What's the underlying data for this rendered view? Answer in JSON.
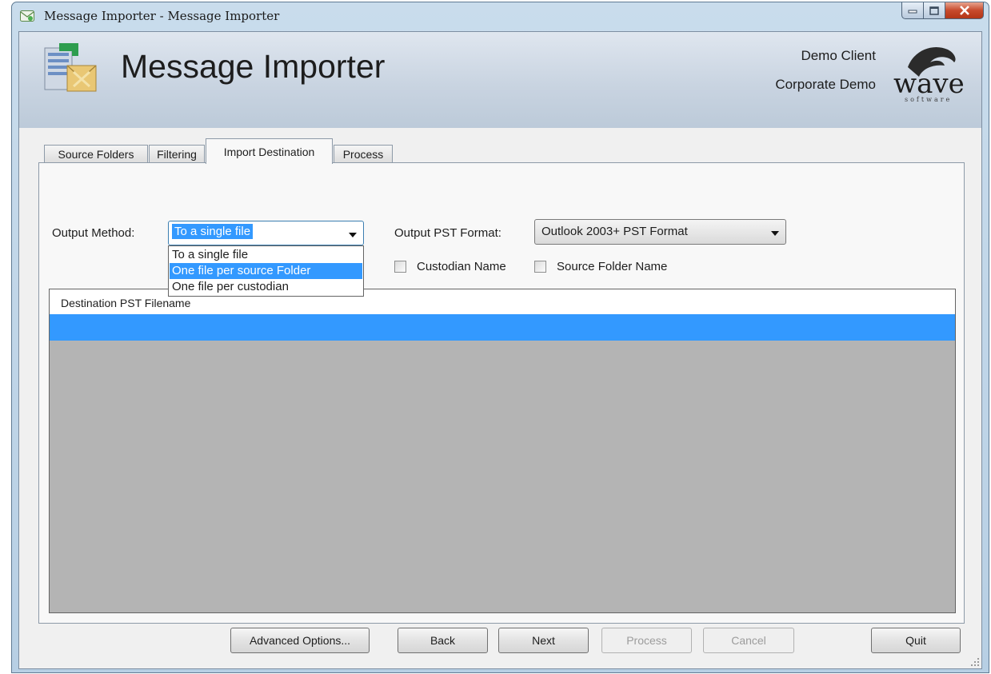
{
  "window": {
    "title": "Message Importer - Message Importer"
  },
  "header": {
    "app_title": "Message Importer",
    "client": "Demo Client",
    "corporate": "Corporate Demo",
    "logo_text": "wave",
    "logo_subtext": "software"
  },
  "tabs": [
    {
      "label": "Source Folders",
      "active": false
    },
    {
      "label": "Filtering",
      "active": false
    },
    {
      "label": "Import Destination",
      "active": true
    },
    {
      "label": "Process",
      "active": false
    }
  ],
  "output_method": {
    "label": "Output Method:",
    "value": "To a single file",
    "options": [
      "To a single file",
      "One file per source Folder",
      "One file per custodian"
    ],
    "highlighted_option": "One file per source Folder"
  },
  "output_pst_format": {
    "label": "Output PST Format:",
    "value": "Outlook 2003+ PST Format"
  },
  "checkboxes": [
    {
      "label": "Custodian Name",
      "checked": false
    },
    {
      "label": "Source Folder Name",
      "checked": false
    }
  ],
  "grid": {
    "column_header": "Destination PST Filename",
    "rows": [
      ""
    ]
  },
  "buttons": {
    "advanced": "Advanced Options...",
    "back": "Back",
    "next": "Next",
    "process": "Process",
    "cancel": "Cancel",
    "quit": "Quit"
  },
  "colors": {
    "selection": "#3399ff",
    "grid_background": "#b4b4b4",
    "close_button": "#c74a2c"
  }
}
